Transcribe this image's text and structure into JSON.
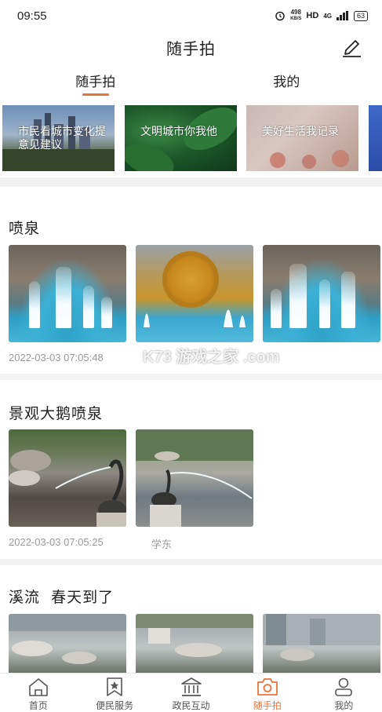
{
  "status_bar": {
    "time": "09:55",
    "speed_value": "498",
    "speed_unit": "KB/S",
    "hd": "HD",
    "network": "4G",
    "battery": "63"
  },
  "header": {
    "title": "随手拍"
  },
  "tabs": [
    {
      "label": "随手拍",
      "active": true
    },
    {
      "label": "我的",
      "active": false
    }
  ],
  "banners": [
    {
      "text": "市民看城市变化提意见建议"
    },
    {
      "text": "文明城市你我他"
    },
    {
      "text": "美好生活我记录"
    }
  ],
  "posts": [
    {
      "title": "喷泉",
      "timestamp": "2022-03-03 07:05:48",
      "author": ""
    },
    {
      "title": "景观大鹅喷泉",
      "timestamp": "2022-03-03 07:05:25",
      "author": "学东"
    },
    {
      "title": "溪流  春天到了",
      "timestamp": "",
      "author": ""
    }
  ],
  "watermark": "K73 游戏之家 .com",
  "bottom_nav": [
    {
      "label": "首页",
      "icon": "home-icon"
    },
    {
      "label": "便民服务",
      "icon": "bookmark-star-icon"
    },
    {
      "label": "政民互动",
      "icon": "government-building-icon"
    },
    {
      "label": "随手拍",
      "icon": "camera-icon",
      "active": true
    },
    {
      "label": "我的",
      "icon": "user-icon"
    }
  ],
  "colors": {
    "accent": "#e8743b",
    "text": "#222222",
    "muted": "#9a9a9a",
    "background": "#f2f2f2"
  }
}
